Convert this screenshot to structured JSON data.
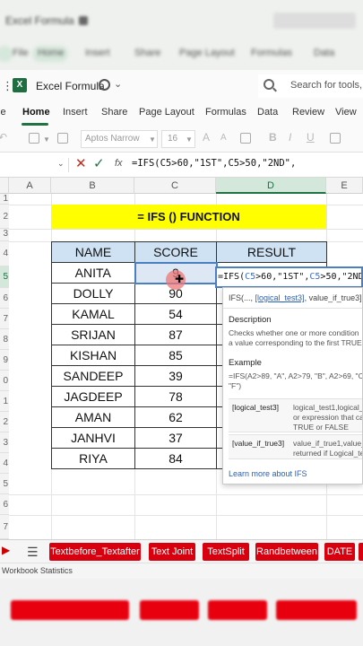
{
  "top_blur": {
    "title": "Excel Formula",
    "tabs": [
      "File",
      "Home",
      "Insert",
      "Share",
      "Page Layout",
      "Formulas",
      "Data"
    ]
  },
  "titlebar": {
    "workbook_name": "Excel Formula",
    "search_placeholder": "Search for tools, h"
  },
  "menu": {
    "items": [
      "le",
      "Home",
      "Insert",
      "Share",
      "Page Layout",
      "Formulas",
      "Data",
      "Review",
      "View"
    ],
    "active": "Home"
  },
  "ribbon": {
    "font_name": "Aptos Narrow",
    "font_size": "16"
  },
  "formula_bar": {
    "text": "=IFS(C5>60,\"1ST\",C5>50,\"2ND\","
  },
  "columns": [
    "A",
    "B",
    "C",
    "D",
    "E"
  ],
  "rows": [
    "1",
    "2",
    "3",
    "4",
    "5",
    "6",
    "7",
    "8",
    "9",
    "0",
    "1",
    "2",
    "3",
    "4",
    "5",
    "6",
    "7"
  ],
  "banner": "= IFS () FUNCTION",
  "table": {
    "headers": [
      "NAME",
      "SCORE",
      "RESULT"
    ],
    "rows": [
      [
        "ANITA",
        "9"
      ],
      [
        "DOLLY",
        "90"
      ],
      [
        "KAMAL",
        "54"
      ],
      [
        "SRIJAN",
        "87"
      ],
      [
        "KISHAN",
        "85"
      ],
      [
        "SANDEEP",
        "39"
      ],
      [
        "JAGDEEP",
        "78"
      ],
      [
        "AMAN",
        "62"
      ],
      [
        "JANHVI",
        "37"
      ],
      [
        "RIYA",
        "84"
      ]
    ]
  },
  "edit_cell": {
    "p1": "=IFS(",
    "r1": "C5",
    "p2": ">60,\"1ST\",",
    "r2": "C5",
    "p3": ">50,\"2ND\""
  },
  "tooltip": {
    "signature_prefix": "IFS(...,",
    "signature_arg": "[logical_test3]",
    "signature_rest": ", value_if_true3], ...)",
    "description_heading": "Description",
    "description_line1": "Checks whether one or more condition",
    "description_line2": "a value corresponding to the first TRUE",
    "example_heading": "Example",
    "example_line1": "=IFS(A2>89, \"A\", A2>79, \"B\", A2>69, \"C\"",
    "example_line2": "\"F\")",
    "param1_name": "[logical_test3]",
    "param1_l1": "logical_test1,logical_",
    "param1_l2": "or expression that ca",
    "param1_l3": "TRUE or FALSE",
    "param2_name": "[value_if_true3]",
    "param2_l1": "value_if_true1,value_",
    "param2_l2": "returned if Logical_te",
    "learn_more": "Learn more about IFS"
  },
  "sheet_tabs": [
    "Textbefore_Textafter",
    "Text Joint",
    "TextSplit",
    "Randbetween",
    "DATE"
  ],
  "status": "Workbook Statistics",
  "colors": {
    "excel_green": "#217346",
    "banner_yellow": "#ffff00",
    "header_blue": "#cfe2f3",
    "tab_red": "#d8000f"
  }
}
